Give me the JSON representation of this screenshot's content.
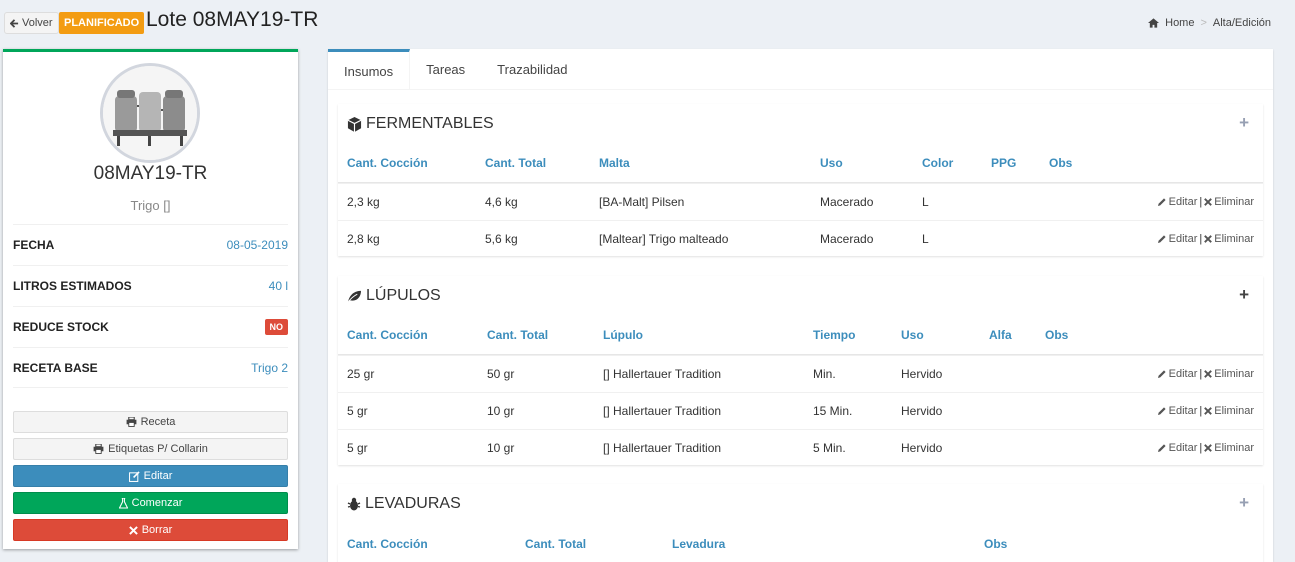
{
  "header": {
    "back_label": "Volver",
    "status": "PLANIFICADO",
    "title": "Lote 08MAY19-TR",
    "breadcrumb": [
      "Home",
      "Alta/Edición"
    ]
  },
  "profile": {
    "name": "08MAY19-TR",
    "subtitle": "Trigo []",
    "info": [
      {
        "label": "FECHA",
        "value": "08-05-2019"
      },
      {
        "label": "LITROS ESTIMADOS",
        "value": "40 l"
      },
      {
        "label": "REDUCE STOCK",
        "value": "NO"
      },
      {
        "label": "RECETA BASE",
        "value": "Trigo 2"
      }
    ],
    "buttons": {
      "receta": "Receta",
      "etiquetas": "Etiquetas P/ Collarin",
      "editar": "Editar",
      "comenzar": "Comenzar",
      "borrar": "Borrar"
    },
    "colors": {
      "accent": "#00a65a",
      "primary": "#3c8dbc",
      "danger": "#dd4b39",
      "warning": "#f39c12"
    }
  },
  "tabs": [
    "Insumos",
    "Tareas",
    "Trazabilidad"
  ],
  "actions": {
    "edit": "Editar",
    "delete": "Eliminar"
  },
  "fermentables": {
    "title": "FERMENTABLES",
    "columns": [
      "Cant. Cocción",
      "Cant. Total",
      "Malta",
      "Uso",
      "Color",
      "PPG",
      "Obs"
    ],
    "rows": [
      [
        "2,3 kg",
        "4,6 kg",
        "[BA-Malt] Pilsen",
        "Macerado",
        "L",
        "",
        ""
      ],
      [
        "2,8 kg",
        "5,6 kg",
        "[Maltear] Trigo malteado",
        "Macerado",
        "L",
        "",
        ""
      ]
    ]
  },
  "lupulos": {
    "title": "LÚPULOS",
    "columns": [
      "Cant. Cocción",
      "Cant. Total",
      "Lúpulo",
      "Tiempo",
      "Uso",
      "Alfa",
      "Obs"
    ],
    "rows": [
      [
        "25 gr",
        "50 gr",
        "[] Hallertauer Tradition",
        "Min.",
        "Hervido",
        "",
        ""
      ],
      [
        "5 gr",
        "10 gr",
        "[] Hallertauer Tradition",
        "15 Min.",
        "Hervido",
        "",
        ""
      ],
      [
        "5 gr",
        "10 gr",
        "[] Hallertauer Tradition",
        "5 Min.",
        "Hervido",
        "",
        ""
      ]
    ]
  },
  "levaduras": {
    "title": "LEVADURAS",
    "columns": [
      "Cant. Cocción",
      "Cant. Total",
      "Levadura",
      "Obs"
    ]
  }
}
